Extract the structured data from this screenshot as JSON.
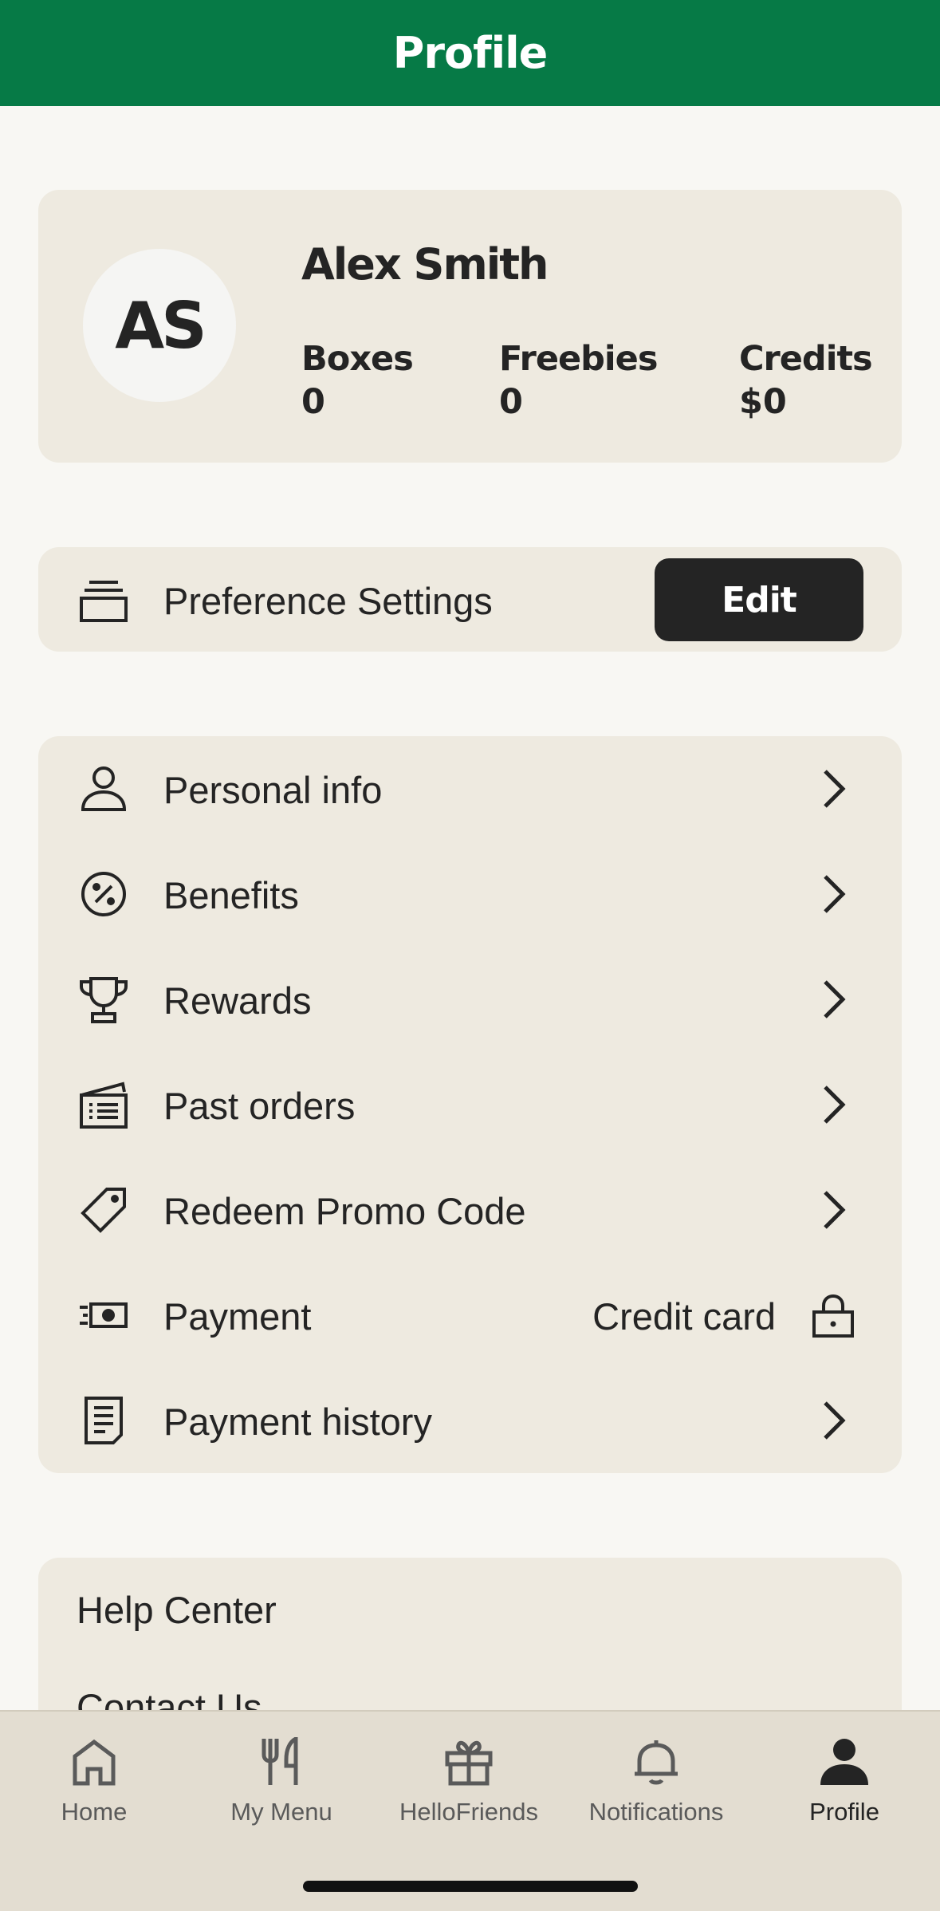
{
  "header": {
    "title": "Profile"
  },
  "profile": {
    "initials": "AS",
    "name": "Alex Smith",
    "stats": [
      {
        "label": "Boxes",
        "value": "0"
      },
      {
        "label": "Freebies",
        "value": "0"
      },
      {
        "label": "Credits",
        "value": "$0"
      }
    ]
  },
  "preferences": {
    "label": "Preference Settings",
    "edit_label": "Edit"
  },
  "menu": {
    "items": [
      {
        "label": "Personal info",
        "icon": "person-icon"
      },
      {
        "label": "Benefits",
        "icon": "percent-badge-icon"
      },
      {
        "label": "Rewards",
        "icon": "trophy-icon"
      },
      {
        "label": "Past orders",
        "icon": "box-list-icon"
      },
      {
        "label": "Redeem Promo Code",
        "icon": "tag-icon"
      },
      {
        "label": "Payment",
        "icon": "cash-icon",
        "value": "Credit card"
      },
      {
        "label": "Payment history",
        "icon": "receipt-icon"
      }
    ]
  },
  "help": {
    "items": [
      "Help Center",
      "Contact Us"
    ]
  },
  "tabbar": {
    "tabs": [
      {
        "label": "Home",
        "icon": "home-icon"
      },
      {
        "label": "My Menu",
        "icon": "fork-knife-icon"
      },
      {
        "label": "HelloFriends",
        "icon": "gift-icon"
      },
      {
        "label": "Notifications",
        "icon": "bell-icon"
      },
      {
        "label": "Profile",
        "icon": "person-icon",
        "active": true
      }
    ]
  },
  "colors": {
    "brand": "#067a46",
    "card": "#eeeae0",
    "background": "#f8f7f3",
    "tabbar": "#e3ddd1",
    "text": "#242424"
  }
}
